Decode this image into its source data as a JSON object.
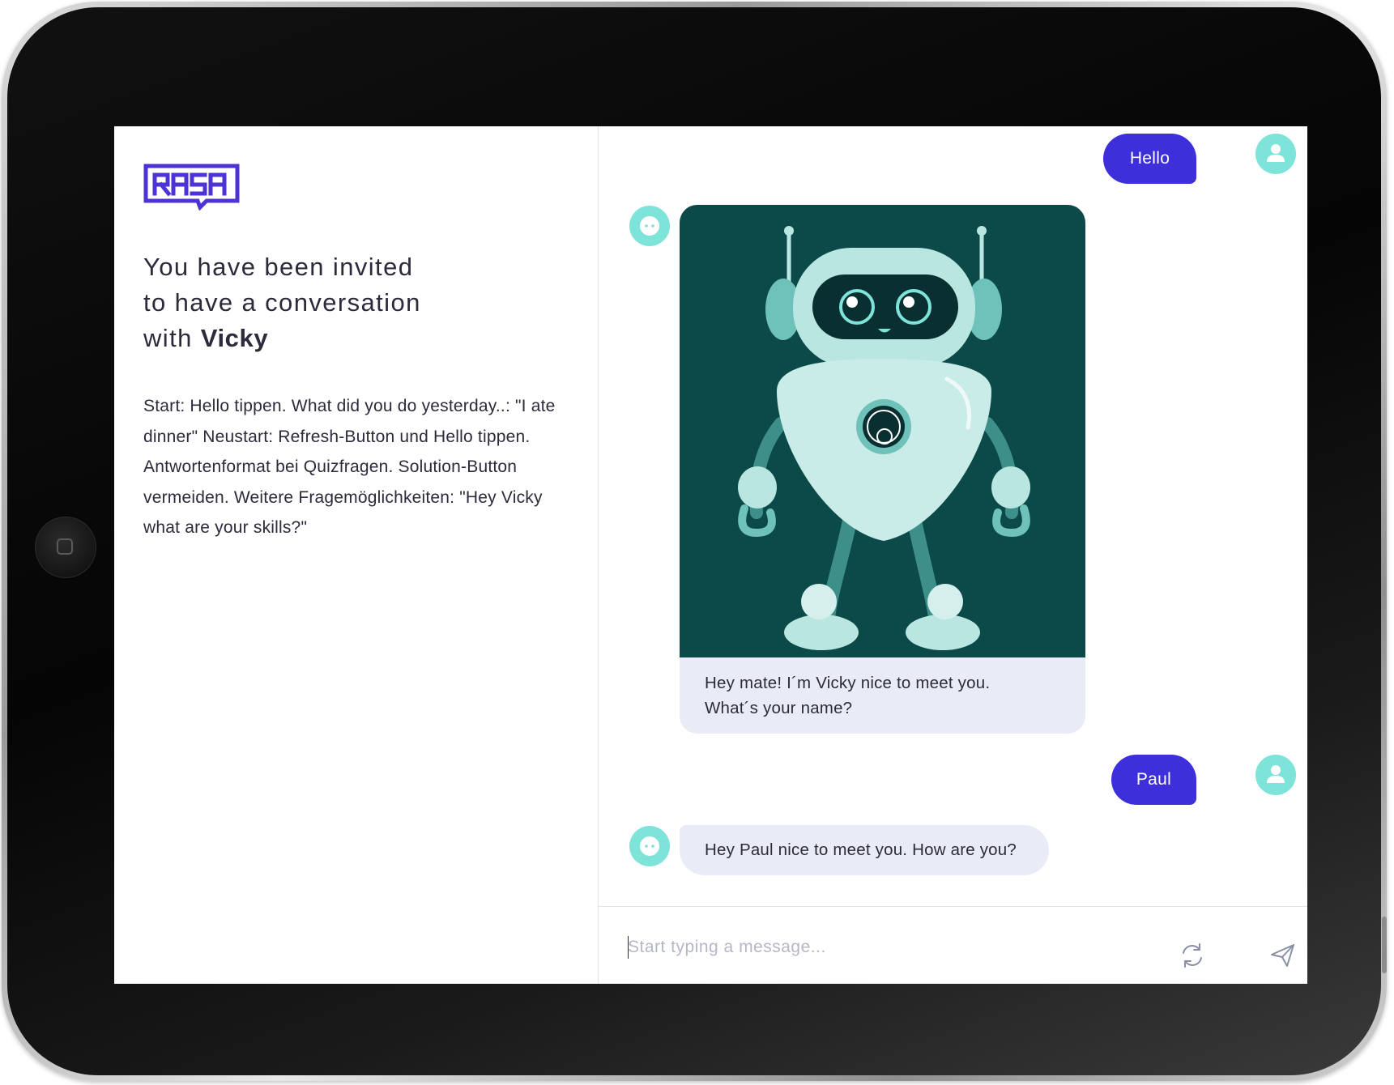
{
  "app": {
    "brand": "RASA",
    "accent_color": "#3d2fd9",
    "avatar_color": "#7ee3d8",
    "bot_bubble_color": "#e9ecf6"
  },
  "intro": {
    "heading_line1": "You have been invited",
    "heading_line2": "to have a conversation",
    "heading_line3_prefix": "with ",
    "bot_name": "Vicky",
    "instructions": "Start: Hello tippen. What did you do yesterday..: \"I ate dinner\" Neustart: Refresh-Button und Hello tippen. Antwortenformat bei Quizfragen. Solution-Button vermeiden. Weitere Fragemöglichkeiten: \"Hey Vicky what are your skills?\""
  },
  "chat": {
    "messages": [
      {
        "sender": "user",
        "text": "Hello",
        "avatar_icon": "user-icon"
      },
      {
        "sender": "bot",
        "type": "image-card",
        "image": "robot-illustration",
        "text_line1": "Hey mate! I´m Vicky nice to meet you.",
        "text_line2": "What´s your name?",
        "avatar_icon": "bot-icon"
      },
      {
        "sender": "user",
        "text": "Paul",
        "avatar_icon": "user-icon"
      },
      {
        "sender": "bot",
        "text": "Hey Paul nice to meet you. How are you?",
        "avatar_icon": "bot-icon"
      }
    ]
  },
  "composer": {
    "placeholder": "Start typing a message...",
    "value": "",
    "refresh_icon": "refresh-icon",
    "send_icon": "send-icon"
  }
}
